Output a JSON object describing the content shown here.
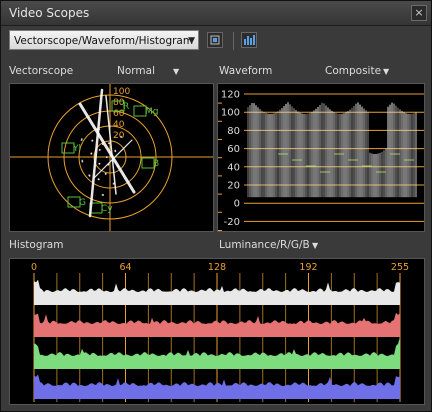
{
  "window": {
    "title": "Video Scopes",
    "close_glyph": "×"
  },
  "toolbar": {
    "layout_select": {
      "value": "Vectorscope/Waveform/Histogram",
      "icon": "chevron-down-icon"
    },
    "buttons": [
      {
        "icon": "reference-monitor-icon"
      },
      {
        "icon": "histogram-bars-icon"
      }
    ]
  },
  "vectorscope": {
    "label": "Vectorscope",
    "mode": "Normal",
    "targets": [
      "R",
      "Mg",
      "B",
      "Cy",
      "G",
      "Yl"
    ],
    "scale_labels": [
      "100",
      "80",
      "60",
      "40",
      "20"
    ]
  },
  "waveform": {
    "label": "Waveform",
    "mode": "Composite",
    "y_axis_labels": [
      "120",
      "100",
      "80",
      "60",
      "40",
      "20",
      "0",
      "-20"
    ]
  },
  "histogram": {
    "label": "Histogram",
    "mode": "Luminance/R/G/B",
    "x_axis_labels": [
      "0",
      "64",
      "128",
      "192",
      "255"
    ],
    "channels": [
      {
        "name": "Luminance",
        "color": "#e8e8e8"
      },
      {
        "name": "R",
        "color": "#e57373"
      },
      {
        "name": "G",
        "color": "#7ddc7d"
      },
      {
        "name": "B",
        "color": "#6f6fe8"
      }
    ]
  },
  "colors": {
    "grid_orange": "#e8a030",
    "panel_bg": "#3a3a3a",
    "scope_bg": "#000000"
  }
}
